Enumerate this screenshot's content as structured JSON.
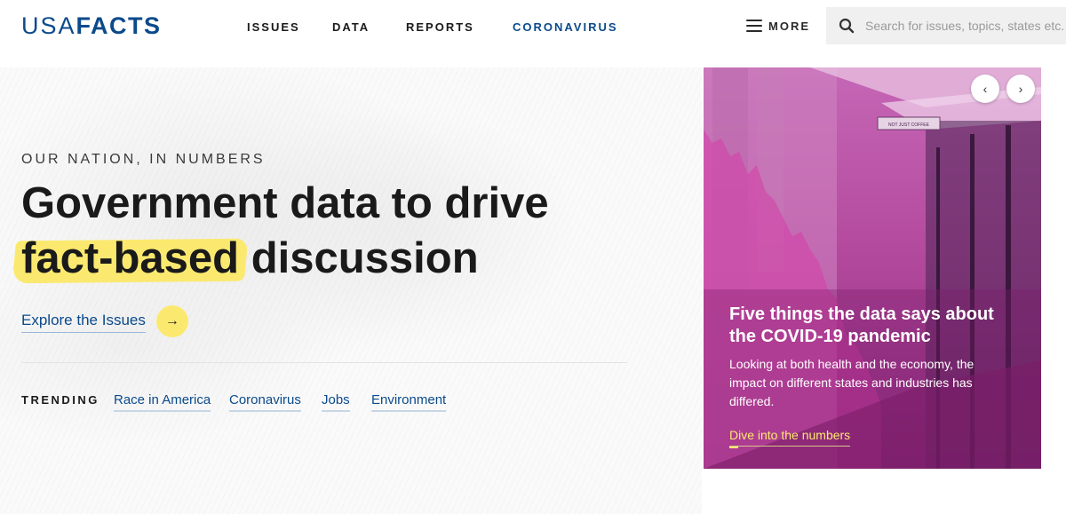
{
  "header": {
    "logo_usa": "USA",
    "logo_facts": "FACTS",
    "nav": [
      {
        "label": "ISSUES"
      },
      {
        "label": "DATA"
      },
      {
        "label": "REPORTS"
      },
      {
        "label": "CORONAVIRUS"
      }
    ],
    "more_label": "MORE",
    "search_placeholder": "Search for issues, topics, states etc..."
  },
  "hero": {
    "eyebrow": "OUR NATION, IN NUMBERS",
    "headline_line1": "Government data to drive",
    "headline_highlight": "fact-based",
    "headline_rest": " discussion",
    "explore_label": "Explore the Issues",
    "trending_label": "TRENDING",
    "trending_links": [
      {
        "label": "Race in America"
      },
      {
        "label": "Coronavirus"
      },
      {
        "label": "Jobs"
      },
      {
        "label": "Environment"
      }
    ]
  },
  "feature": {
    "title": "Five things the data says about the COVID-19 pandemic",
    "body": "Looking at both health and the economy, the impact on different states and industries has differed.",
    "link_label": "Dive into the numbers",
    "sign_text": "NOT JUST COFFEE"
  },
  "colors": {
    "brand_blue": "#0b4a8b",
    "highlight_yellow": "#fbe96f",
    "card_magenta": "#b44a9e"
  }
}
